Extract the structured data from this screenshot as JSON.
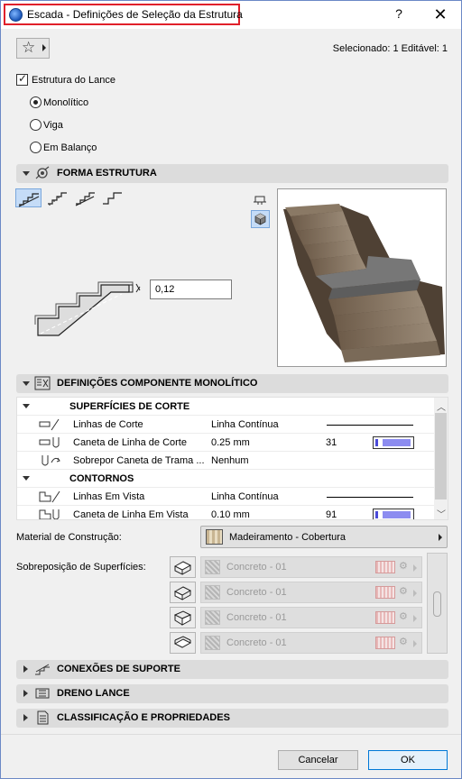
{
  "window": {
    "title": "Escada - Definições de Seleção da Estrutura",
    "help_label": "?",
    "close_label": "✕"
  },
  "toolbar": {
    "favorites_icon": "star-icon",
    "selection_info": "Selecionado: 1 Editável: 1"
  },
  "structure": {
    "checkbox_label": "Estrutura do Lance",
    "checked": true,
    "options": [
      {
        "label": "Monolítico",
        "selected": true
      },
      {
        "label": "Viga",
        "selected": false
      },
      {
        "label": "Em Balanço",
        "selected": false
      }
    ]
  },
  "sections": {
    "forma": {
      "title": "FORMA ESTRUTURA",
      "expanded": true
    },
    "componente": {
      "title": "DEFINIÇÕES COMPONENTE MONOLÍTICO",
      "expanded": true
    },
    "conexoes": {
      "title": "CONEXÕES DE SUPORTE",
      "expanded": false
    },
    "dreno": {
      "title": "DRENO LANCE",
      "expanded": false
    },
    "classificacao": {
      "title": "CLASSIFICAÇÃO E PROPRIEDADES",
      "expanded": false
    }
  },
  "forma": {
    "thickness_value": "0,12"
  },
  "grid": {
    "groups": [
      {
        "header": "SUPERFÍCIES DE CORTE",
        "rows": [
          {
            "name": "Linhas de Corte",
            "value": "Linha Contínua",
            "extra": "line"
          },
          {
            "name": "Caneta de Linha de Corte",
            "value": "0.25 mm",
            "number": "31",
            "extra": "pen"
          },
          {
            "name": "Sobrepor Caneta de Trama ...",
            "value": "Nenhum",
            "extra": "none"
          }
        ]
      },
      {
        "header": "CONTORNOS",
        "rows": [
          {
            "name": "Linhas Em Vista",
            "value": "Linha Contínua",
            "extra": "line"
          },
          {
            "name": "Caneta de Linha Em Vista",
            "value": "0.10 mm",
            "number": "91",
            "extra": "pen"
          }
        ]
      }
    ]
  },
  "material": {
    "label": "Material de Construção:",
    "value": "Madeiramento - Cobertura"
  },
  "overrides": {
    "label": "Sobreposição de Superfícies:",
    "items": [
      {
        "value": "Concreto - 01"
      },
      {
        "value": "Concreto - 01"
      },
      {
        "value": "Concreto - 01"
      },
      {
        "value": "Concreto - 01"
      }
    ]
  },
  "footer": {
    "cancel_label": "Cancelar",
    "ok_label": "OK"
  },
  "colors": {
    "title_highlight": "#e0202a",
    "selected_tool": "#c5dcf7",
    "pen_color": "#8c8cf0"
  }
}
